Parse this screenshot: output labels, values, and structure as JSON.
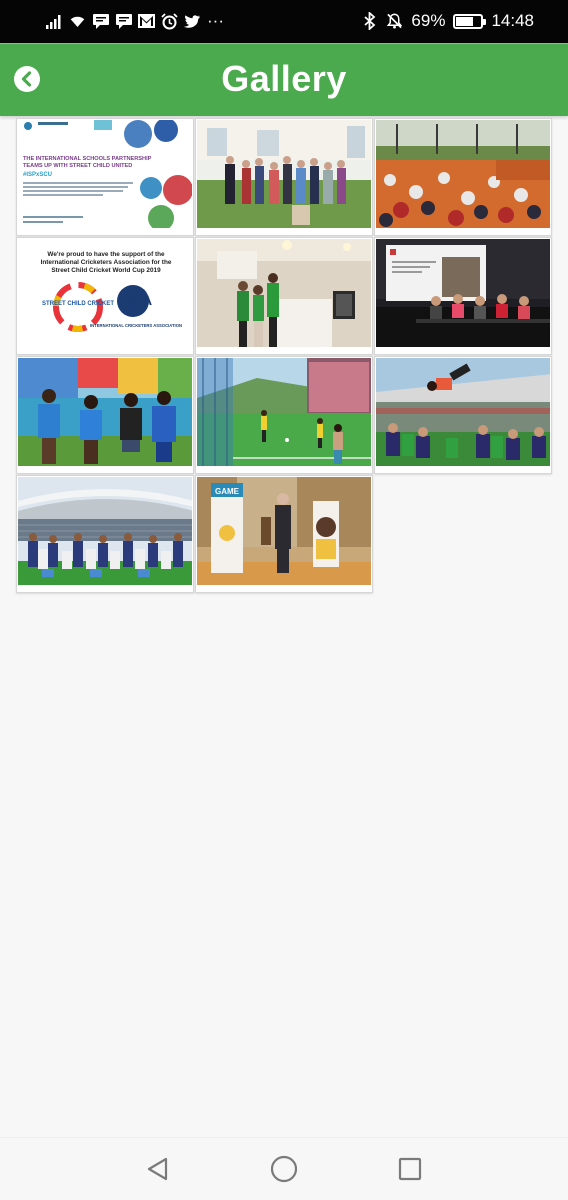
{
  "status_bar": {
    "battery_percent": "69%",
    "battery_level": 0.69,
    "time": "14:48",
    "more_indicator": "···",
    "icons": [
      "signal-icon",
      "wifi-icon",
      "message-icon",
      "message-icon",
      "gmail-icon",
      "alarm-icon",
      "twitter-icon",
      "bluetooth-icon",
      "mute-icon",
      "battery-icon"
    ]
  },
  "header": {
    "title": "Gallery",
    "back_icon": "chevron-left-circle-icon",
    "color": "#4caa4e"
  },
  "gallery": {
    "items": [
      {
        "caption": "",
        "kind": "isp-poster",
        "text": {
          "head": "THE INTERNATIONAL SCHOOLS PARTNERSHIP",
          "head2": "TEAMS UP WITH STREET CHILD UNITED",
          "tag": "#ISPxSCU"
        }
      },
      {
        "caption": "",
        "kind": "group-photo-garden"
      },
      {
        "caption": "",
        "kind": "children-sitting"
      },
      {
        "caption": "",
        "kind": "ica-poster",
        "text": {
          "line1": "We're proud to have the support of the",
          "line2": "International Cricketers Association for the",
          "line3": "Street Child Cricket World Cup 2019",
          "logo_a": "STREET CHILD CRICKET",
          "logo_b": "ICA",
          "logo_b_sub": "INTERNATIONAL CRICKETERS ASSOCIATION"
        }
      },
      {
        "caption": "",
        "kind": "speaker-podium"
      },
      {
        "caption": "",
        "kind": "panel-conference"
      },
      {
        "caption": "",
        "kind": "football-girls-mural"
      },
      {
        "caption": "",
        "kind": "football-pitch-favela"
      },
      {
        "caption": "",
        "kind": "stadium-celebration"
      },
      {
        "caption": "",
        "kind": "stadium-team-photo"
      },
      {
        "caption": "",
        "kind": "speaker-banners",
        "text": {
          "banner": "GAME"
        }
      }
    ]
  },
  "nav_bar": {
    "back_icon": "triangle-back-icon",
    "home_icon": "circle-home-icon",
    "recents_icon": "square-recents-icon"
  }
}
